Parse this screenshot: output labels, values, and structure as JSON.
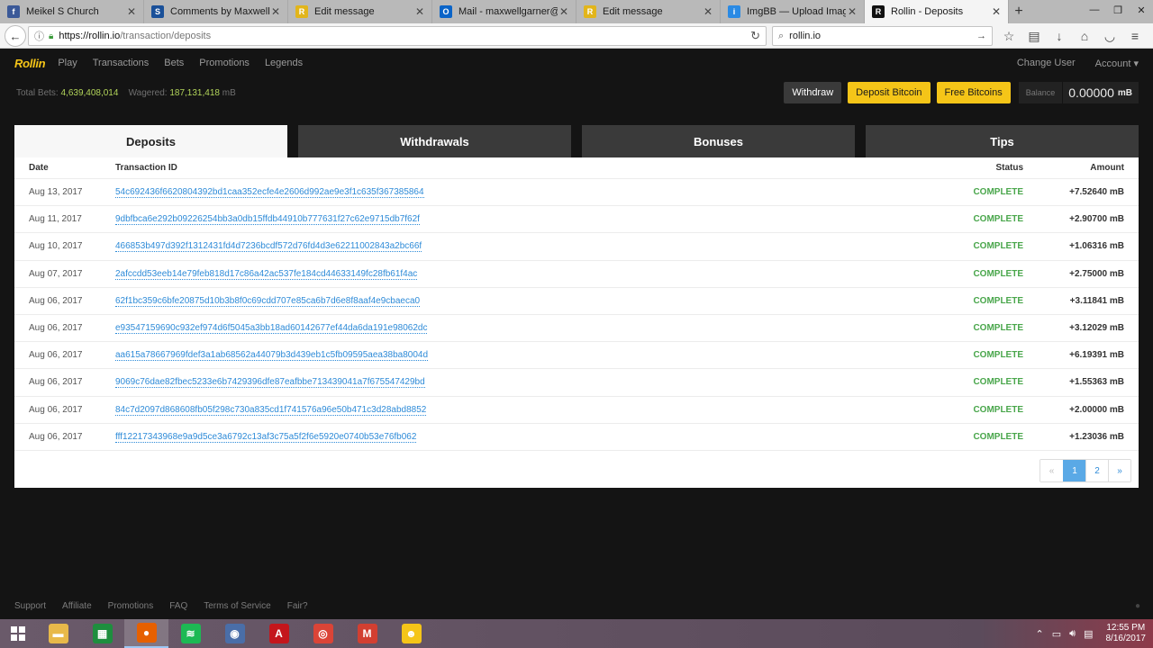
{
  "browser": {
    "tabs": [
      {
        "title": "Meikel S Church",
        "icon": "facebook-icon",
        "color": "#3b5998",
        "glyph": "f"
      },
      {
        "title": "Comments by Maxwell (@",
        "icon": "steemit-icon",
        "color": "#1a5099",
        "glyph": "S"
      },
      {
        "title": "Edit message",
        "icon": "rollin-icon",
        "color": "#e2b51b",
        "glyph": "R"
      },
      {
        "title": "Mail - maxwellgarner@live",
        "icon": "outlook-icon",
        "color": "#0a64c8",
        "glyph": "O"
      },
      {
        "title": "Edit message",
        "icon": "rollin-icon",
        "color": "#e2b51b",
        "glyph": "R"
      },
      {
        "title": "ImgBB — Upload Image —",
        "icon": "imgbb-icon",
        "color": "#2a8ae4",
        "glyph": "i"
      },
      {
        "title": "Rollin - Deposits",
        "icon": "rollin-r-icon",
        "color": "#111111",
        "glyph": "R",
        "active": true
      }
    ],
    "url_host": "https://rollin.io",
    "url_path": "/transaction/deposits",
    "search_value": "rollin.io"
  },
  "site": {
    "logo": "Rollin",
    "nav": [
      "Play",
      "Transactions",
      "Bets",
      "Promotions",
      "Legends"
    ],
    "nav_right": {
      "change_user": "Change User",
      "account": "Account ▾"
    },
    "stats": {
      "total_bets_label": "Total Bets:",
      "total_bets": "4,639,408,014",
      "wagered_label": "Wagered:",
      "wagered": "187,131,418",
      "wagered_unit": "mB"
    },
    "buttons": {
      "withdraw": "Withdraw",
      "deposit": "Deposit Bitcoin",
      "free": "Free Bitcoins"
    },
    "balance": {
      "label": "Balance",
      "value": "0.00000",
      "unit": "mB"
    },
    "tabs": [
      "Deposits",
      "Withdrawals",
      "Bonuses",
      "Tips"
    ],
    "table": {
      "headers": {
        "date": "Date",
        "tx": "Transaction ID",
        "status": "Status",
        "amount": "Amount"
      },
      "rows": [
        {
          "date": "Aug 13, 2017",
          "tx": "54c692436f6620804392bd1caa352ecfe4e2606d992ae9e3f1c635f367385864",
          "status": "COMPLETE",
          "amount": "+7.52640 mB"
        },
        {
          "date": "Aug 11, 2017",
          "tx": "9dbfbca6e292b09226254bb3a0db15ffdb44910b777631f27c62e9715db7f62f",
          "status": "COMPLETE",
          "amount": "+2.90700 mB"
        },
        {
          "date": "Aug 10, 2017",
          "tx": "466853b497d392f1312431fd4d7236bcdf572d76fd4d3e62211002843a2bc66f",
          "status": "COMPLETE",
          "amount": "+1.06316 mB"
        },
        {
          "date": "Aug 07, 2017",
          "tx": "2afccdd53eeb14e79feb818d17c86a42ac537fe184cd44633149fc28fb61f4ac",
          "status": "COMPLETE",
          "amount": "+2.75000 mB"
        },
        {
          "date": "Aug 06, 2017",
          "tx": "62f1bc359c6bfe20875d10b3b8f0c69cdd707e85ca6b7d6e8f8aaf4e9cbaeca0",
          "status": "COMPLETE",
          "amount": "+3.11841 mB"
        },
        {
          "date": "Aug 06, 2017",
          "tx": "e93547159690c932ef974d6f5045a3bb18ad60142677ef44da6da191e98062dc",
          "status": "COMPLETE",
          "amount": "+3.12029 mB"
        },
        {
          "date": "Aug 06, 2017",
          "tx": "aa615a78667969fdef3a1ab68562a44079b3d439eb1c5fb09595aea38ba8004d",
          "status": "COMPLETE",
          "amount": "+6.19391 mB"
        },
        {
          "date": "Aug 06, 2017",
          "tx": "9069c76dae82fbec5233e6b7429396dfe87eafbbe713439041a7f675547429bd",
          "status": "COMPLETE",
          "amount": "+1.55363 mB"
        },
        {
          "date": "Aug 06, 2017",
          "tx": "84c7d2097d868608fb05f298c730a835cd1f741576a96e50b471c3d28abd8852",
          "status": "COMPLETE",
          "amount": "+2.00000 mB"
        },
        {
          "date": "Aug 06, 2017",
          "tx": "fff12217343968e9a9d5ce3a6792c13af3c75a5f2f6e5920e0740b53e76fb062",
          "status": "COMPLETE",
          "amount": "+1.23036 mB"
        }
      ]
    },
    "pager": {
      "prev": "«",
      "pages": [
        "1",
        "2"
      ],
      "current": "1",
      "next": "»"
    },
    "footer": [
      "Support",
      "Affiliate",
      "Promotions",
      "FAQ",
      "Terms of Service",
      "Fair?"
    ]
  },
  "taskbar": {
    "apps": [
      {
        "name": "file-explorer-icon",
        "color": "#e8b94a",
        "glyph": "▬"
      },
      {
        "name": "store-icon",
        "color": "#1e8e3e",
        "glyph": "▦"
      },
      {
        "name": "firefox-icon",
        "color": "#e66000",
        "glyph": "●",
        "selected": true
      },
      {
        "name": "spotify-icon",
        "color": "#1db954",
        "glyph": "≋"
      },
      {
        "name": "media-app-icon",
        "color": "#4a6ea8",
        "glyph": "◉"
      },
      {
        "name": "acrobat-icon",
        "color": "#c4161c",
        "glyph": "A"
      },
      {
        "name": "chrome-icon",
        "color": "#db4437",
        "glyph": "◎"
      },
      {
        "name": "gmail-icon",
        "color": "#d23f31",
        "glyph": "M"
      },
      {
        "name": "cyberghost-icon",
        "color": "#f5c518",
        "glyph": "☻"
      }
    ],
    "time": "12:55 PM",
    "date": "8/16/2017"
  }
}
